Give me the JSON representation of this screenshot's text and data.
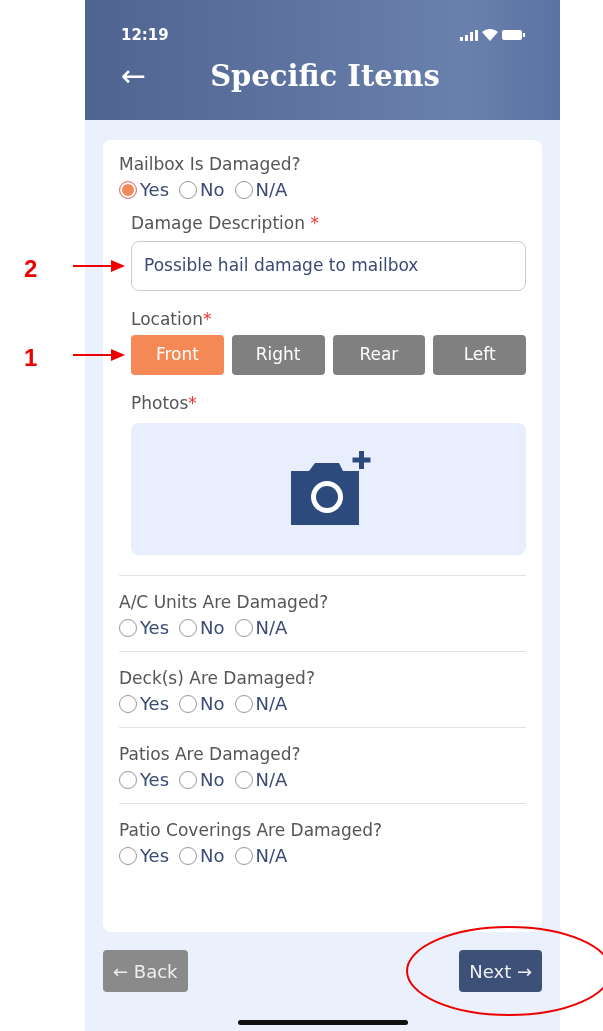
{
  "status_bar": {
    "time": "12:19"
  },
  "header": {
    "back": "←",
    "title": "Specific Items"
  },
  "questions": [
    {
      "label": "Mailbox Is Damaged?",
      "options": [
        {
          "label": "Yes",
          "selected": true
        },
        {
          "label": "No",
          "selected": false
        },
        {
          "label": "N/A",
          "selected": false
        }
      ],
      "details": {
        "description": {
          "label": "Damage Description",
          "required_mark": "*",
          "value": "Possible hail damage to mailbox",
          "annotation": "2"
        },
        "location": {
          "label": "Location",
          "required_mark": "*",
          "annotation": "1",
          "options": [
            {
              "label": "Front",
              "selected": true
            },
            {
              "label": "Right",
              "selected": false
            },
            {
              "label": "Rear",
              "selected": false
            },
            {
              "label": "Left",
              "selected": false
            }
          ]
        },
        "photos": {
          "label": "Photos",
          "required_mark": "*"
        }
      }
    },
    {
      "label": "A/C Units Are Damaged?",
      "options": [
        {
          "label": "Yes",
          "selected": false
        },
        {
          "label": "No",
          "selected": false
        },
        {
          "label": "N/A",
          "selected": false
        }
      ]
    },
    {
      "label": "Deck(s) Are Damaged?",
      "options": [
        {
          "label": "Yes",
          "selected": false
        },
        {
          "label": "No",
          "selected": false
        },
        {
          "label": "N/A",
          "selected": false
        }
      ]
    },
    {
      "label": "Patios Are Damaged?",
      "options": [
        {
          "label": "Yes",
          "selected": false
        },
        {
          "label": "No",
          "selected": false
        },
        {
          "label": "N/A",
          "selected": false
        }
      ]
    },
    {
      "label": "Patio Coverings Are Damaged?",
      "options": [
        {
          "label": "Yes",
          "selected": false
        },
        {
          "label": "No",
          "selected": false
        },
        {
          "label": "N/A",
          "selected": false
        }
      ]
    }
  ],
  "footer": {
    "back": {
      "label": "← Back",
      "disabled": true
    },
    "next": {
      "label": "Next →",
      "disabled": false,
      "highlighted": true
    }
  }
}
